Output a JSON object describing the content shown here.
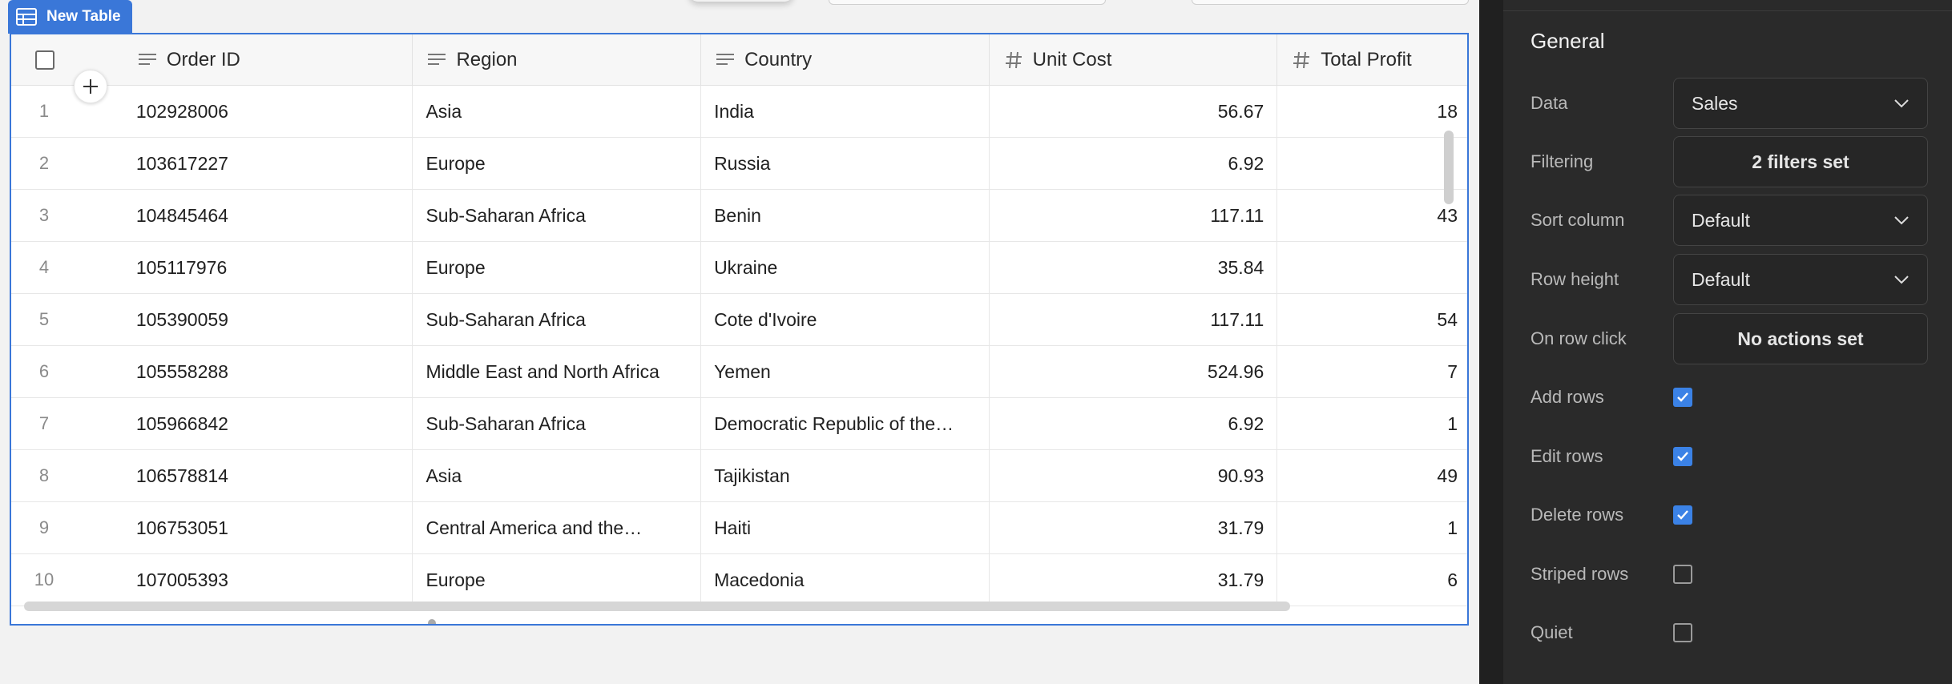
{
  "widget": {
    "tag_label": "New Table"
  },
  "table": {
    "columns": [
      {
        "key": "order_id",
        "label": "Order ID",
        "icon": "text-column-icon"
      },
      {
        "key": "region",
        "label": "Region",
        "icon": "text-column-icon"
      },
      {
        "key": "country",
        "label": "Country",
        "icon": "text-column-icon"
      },
      {
        "key": "unit_cost",
        "label": "Unit Cost",
        "icon": "hash-icon"
      },
      {
        "key": "total_profit",
        "label": "Total Profit",
        "icon": "hash-icon"
      }
    ],
    "rows": [
      {
        "n": "1",
        "order_id": "102928006",
        "region": "Asia",
        "country": "India",
        "unit_cost": "56.67",
        "total_profit": "18"
      },
      {
        "n": "2",
        "order_id": "103617227",
        "region": "Europe",
        "country": "Russia",
        "unit_cost": "6.92",
        "total_profit": ""
      },
      {
        "n": "3",
        "order_id": "104845464",
        "region": "Sub-Saharan Africa",
        "country": "Benin",
        "unit_cost": "117.11",
        "total_profit": "43"
      },
      {
        "n": "4",
        "order_id": "105117976",
        "region": "Europe",
        "country": "Ukraine",
        "unit_cost": "35.84",
        "total_profit": ""
      },
      {
        "n": "5",
        "order_id": "105390059",
        "region": "Sub-Saharan Africa",
        "country": "Cote d'Ivoire",
        "unit_cost": "117.11",
        "total_profit": "54"
      },
      {
        "n": "6",
        "order_id": "105558288",
        "region": "Middle East and North Africa",
        "country": "Yemen",
        "unit_cost": "524.96",
        "total_profit": "7"
      },
      {
        "n": "7",
        "order_id": "105966842",
        "region": "Sub-Saharan Africa",
        "country": "Democratic Republic of the…",
        "unit_cost": "6.92",
        "total_profit": "1"
      },
      {
        "n": "8",
        "order_id": "106578814",
        "region": "Asia",
        "country": "Tajikistan",
        "unit_cost": "90.93",
        "total_profit": "49"
      },
      {
        "n": "9",
        "order_id": "106753051",
        "region": "Central America and the…",
        "country": "Haiti",
        "unit_cost": "31.79",
        "total_profit": "1"
      },
      {
        "n": "10",
        "order_id": "107005393",
        "region": "Europe",
        "country": "Macedonia",
        "unit_cost": "31.79",
        "total_profit": "6"
      }
    ]
  },
  "panel": {
    "title": "General",
    "data_label": "Data",
    "data_value": "Sales",
    "filtering_label": "Filtering",
    "filtering_value": "2 filters set",
    "sort_label": "Sort column",
    "sort_value": "Default",
    "row_height_label": "Row height",
    "row_height_value": "Default",
    "on_row_click_label": "On row click",
    "on_row_click_value": "No actions set",
    "add_rows_label": "Add rows",
    "add_rows_checked": true,
    "edit_rows_label": "Edit rows",
    "edit_rows_checked": true,
    "delete_rows_label": "Delete rows",
    "delete_rows_checked": true,
    "striped_rows_label": "Striped rows",
    "striped_rows_checked": false,
    "quiet_label": "Quiet",
    "quiet_checked": false
  },
  "colors": {
    "accent": "#3a77d8",
    "panel_bg": "#2a2a2a",
    "check_on": "#3b82e6"
  }
}
